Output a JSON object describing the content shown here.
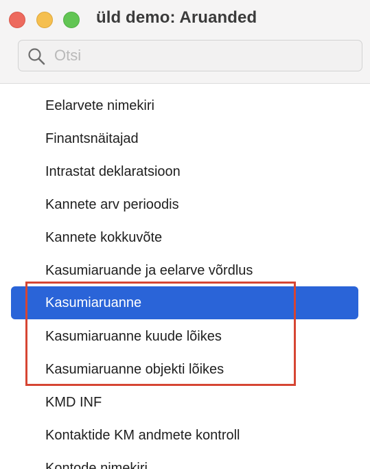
{
  "window": {
    "title": "üld demo: Aruanded"
  },
  "search": {
    "placeholder": "Otsi",
    "value": ""
  },
  "reports": {
    "items": [
      {
        "label": "Eelarvete nimekiri"
      },
      {
        "label": "Finantsnäitajad"
      },
      {
        "label": "Intrastat deklaratsioon"
      },
      {
        "label": "Kannete arv perioodis"
      },
      {
        "label": "Kannete kokkuvõte"
      },
      {
        "label": "Kasumiaruande ja eelarve võrdlus"
      },
      {
        "label": "Kasumiaruanne",
        "selected": true
      },
      {
        "label": "Kasumiaruanne kuude lõikes"
      },
      {
        "label": "Kasumiaruanne objekti lõikes"
      },
      {
        "label": "KMD INF"
      },
      {
        "label": "Kontaktide KM andmete kontroll"
      },
      {
        "label": "Kontode nimekiri"
      }
    ]
  },
  "colors": {
    "selection": "#2a64d8",
    "highlight_border": "#d64533",
    "close": "#ed6a5e",
    "minimize": "#f5bf4f",
    "maximize": "#62c554"
  }
}
